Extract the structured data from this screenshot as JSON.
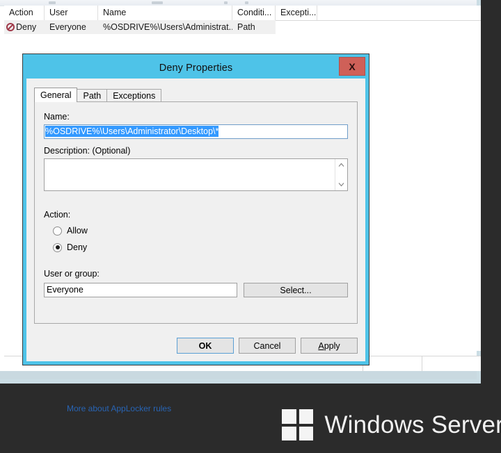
{
  "console": {
    "list": {
      "columns": [
        {
          "key": "action",
          "label": "Action"
        },
        {
          "key": "user",
          "label": "User"
        },
        {
          "key": "name",
          "label": "Name"
        },
        {
          "key": "condition",
          "label": "Conditi..."
        },
        {
          "key": "exceptions",
          "label": "Excepti..."
        }
      ],
      "rows": [
        {
          "action_icon": "deny-circle-slash-icon",
          "action": "Deny",
          "user": "Everyone",
          "name": "%OSDRIVE%\\Users\\Administrat...",
          "condition": "Path",
          "exceptions": ""
        }
      ]
    }
  },
  "dialog": {
    "title": "Deny Properties",
    "close_label": "X",
    "tabs": [
      {
        "label": "General",
        "active": true
      },
      {
        "label": "Path",
        "active": false
      },
      {
        "label": "Exceptions",
        "active": false
      }
    ],
    "general": {
      "name_label": "Name:",
      "name_value": "%OSDRIVE%\\Users\\Administrator\\Desktop\\*",
      "description_label": "Description: (Optional)",
      "description_value": "",
      "description_placeholder": "",
      "scroll_up_icon": "chevron-up-icon",
      "scroll_down_icon": "chevron-down-icon",
      "action_label": "Action:",
      "action_options": [
        {
          "label": "Allow",
          "selected": false
        },
        {
          "label": "Deny",
          "selected": true
        }
      ],
      "user_group_label": "User or group:",
      "user_group_value": "Everyone",
      "select_button": "Select..."
    },
    "help_link": "More about AppLocker rules",
    "buttons": [
      {
        "label": "OK",
        "default": true,
        "accel": ""
      },
      {
        "label": "Cancel",
        "default": false,
        "accel": ""
      },
      {
        "label": "Apply",
        "default": false,
        "accel": "A"
      }
    ]
  },
  "branding": {
    "text": "Windows Server",
    "logo_icon": "windows-logo-icon"
  },
  "colors": {
    "dialog_accent": "#4ec3e8",
    "close_button": "#cf6058",
    "selection": "#3399ff",
    "link": "#2864b4",
    "deny_icon": "#a03a4a",
    "desktop": "#2b2b2b"
  }
}
